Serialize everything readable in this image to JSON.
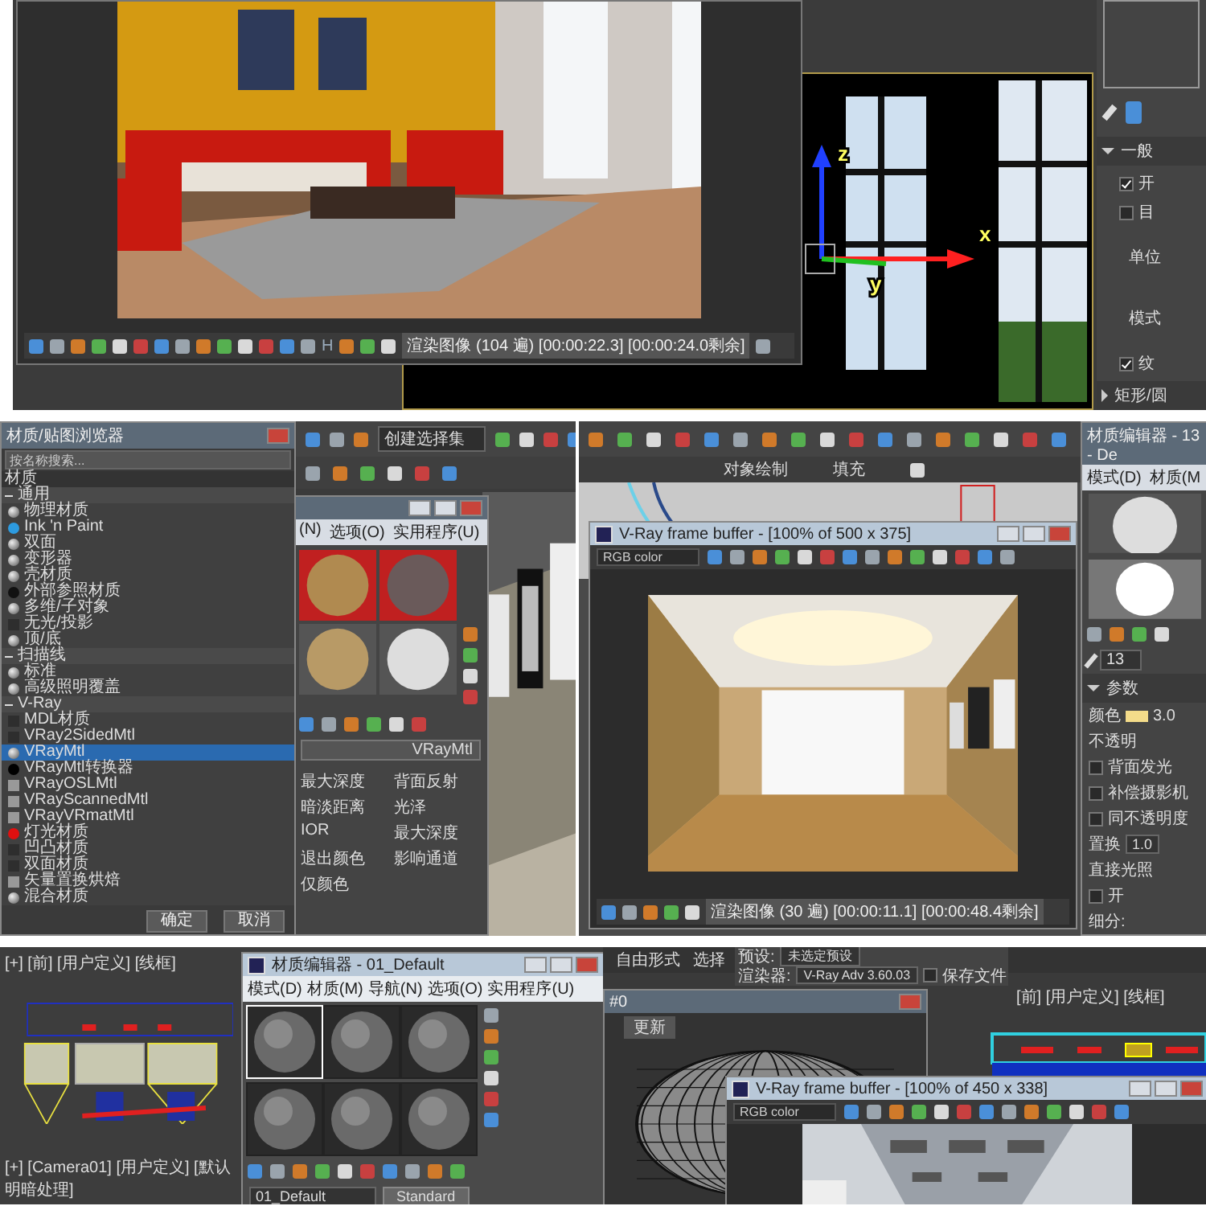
{
  "top_panel": {
    "render_window": {
      "toolbar_glyph": "H",
      "status": "渲染图像 (104 遍) [00:00:22.3] [00:00:24.0剩余]"
    },
    "viewport": {
      "axis_labels": [
        "z",
        "x",
        "y"
      ]
    },
    "command_panel": {
      "sections": [
        {
          "title": "一般",
          "expanded": true,
          "rows": [
            {
              "kind": "check",
              "label": "开",
              "checked": true
            },
            {
              "kind": "check",
              "label": "目",
              "checked": false
            },
            {
              "kind": "text",
              "label": "单位"
            },
            {
              "kind": "text",
              "label": "模式"
            },
            {
              "kind": "check",
              "label": "纹",
              "checked": true
            }
          ]
        },
        {
          "title": "矩形/圆",
          "expanded": false
        }
      ]
    }
  },
  "middle_left_panel": {
    "toolbar": {
      "dropdown": "创建选择集"
    },
    "material_browser": {
      "title": "材质/贴图浏览器",
      "search_placeholder": "按名称搜索...",
      "root": "材质",
      "groups": [
        {
          "title": "通用",
          "expanded": true,
          "items": [
            {
              "label": "物理材质",
              "kind": "sphere",
              "selected": false
            },
            {
              "label": "Ink 'n Paint",
              "kind": "dot",
              "color": "#2d9be0",
              "selected": false
            },
            {
              "label": "双面",
              "kind": "sphere",
              "selected": false
            },
            {
              "label": "变形器",
              "kind": "sphere",
              "selected": false
            },
            {
              "label": "壳材质",
              "kind": "sphere",
              "selected": false
            },
            {
              "label": "外部参照材质",
              "kind": "dot",
              "color": "#111111",
              "selected": false
            },
            {
              "label": "多维/子对象",
              "kind": "sphere",
              "selected": false
            },
            {
              "label": "无光/投影",
              "kind": "none",
              "selected": false
            },
            {
              "label": "顶/底",
              "kind": "sphere",
              "selected": false
            }
          ]
        },
        {
          "title": "扫描线",
          "expanded": true,
          "items": [
            {
              "label": "标准",
              "kind": "sphere",
              "selected": false
            },
            {
              "label": "高级照明覆盖",
              "kind": "sphere",
              "selected": false
            }
          ]
        },
        {
          "title": "V-Ray",
          "expanded": true,
          "items": [
            {
              "label": "MDL材质",
              "kind": "none",
              "selected": false
            },
            {
              "label": "VRay2SidedMtl",
              "kind": "none",
              "selected": false
            },
            {
              "label": "VRayMtl",
              "kind": "sphere",
              "selected": true
            },
            {
              "label": "VRayMtl转换器",
              "kind": "dot",
              "color": "#000000",
              "selected": false
            },
            {
              "label": "VRayOSLMtl",
              "kind": "swatch",
              "selected": false
            },
            {
              "label": "VRayScannedMtl",
              "kind": "swatch",
              "selected": false
            },
            {
              "label": "VRayVRmatMtl",
              "kind": "swatch",
              "selected": false
            },
            {
              "label": "灯光材质",
              "kind": "dot",
              "color": "#e01010",
              "selected": false
            },
            {
              "label": "凹凸材质",
              "kind": "none",
              "selected": false
            },
            {
              "label": "双面材质",
              "kind": "none",
              "selected": false
            },
            {
              "label": "矢量置换烘焙",
              "kind": "swatch",
              "selected": false
            },
            {
              "label": "混合材质",
              "kind": "sphere",
              "selected": false
            }
          ]
        }
      ],
      "buttons": [
        "确定",
        "取消"
      ]
    },
    "material_editor": {
      "menu": [
        "(N)",
        "选项(O)",
        "实用程序(U)"
      ],
      "material_type": "VRayMtl",
      "parameters": [
        "最大深度",
        "背面反射",
        "暗淡距离",
        "光泽",
        "IOR",
        "最大深度",
        "退出颜色",
        "影响通道",
        "仅颜色"
      ]
    }
  },
  "middle_right_panel": {
    "ribbon_labels": [
      "对象绘制",
      "填充"
    ],
    "frame_buffer": {
      "title": "V-Ray frame buffer - [100% of 500 x 375]",
      "channel": "RGB color",
      "status": "渲染图像 (30 遍) [00:00:11.1] [00:00:48.4剩余]"
    },
    "material_editor": {
      "title": "材质编辑器 - 13 - De",
      "menu": [
        "模式(D)",
        "材质(M"
      ],
      "slot_name": "13",
      "rollout": "参数",
      "rows": [
        {
          "kind": "color",
          "label": "颜色",
          "value": "3.0"
        },
        {
          "kind": "text",
          "label": "不透明"
        },
        {
          "kind": "check",
          "label": "背面发光",
          "checked": false
        },
        {
          "kind": "check",
          "label": "补偿摄影机",
          "checked": false
        },
        {
          "kind": "check",
          "label": "同不透明度",
          "checked": false
        },
        {
          "kind": "spinner",
          "label": "置换",
          "value": "1.0"
        },
        {
          "kind": "text",
          "label": "直接光照"
        },
        {
          "kind": "check",
          "label": "开",
          "checked": false
        },
        {
          "kind": "text",
          "label": "细分:"
        }
      ]
    }
  },
  "bottom_left_panel": {
    "viewport_label": "[+] [前] [用户定义] [线框]",
    "camera_label": "[+] [Camera01] [用户定义] [默认明暗处理]",
    "material_editor": {
      "title": "材质编辑器 - 01_Default",
      "menu": [
        "模式(D)",
        "材质(M)",
        "导航(N)",
        "选项(O)",
        "实用程序(U)"
      ],
      "slots": [
        {
          "selected": true
        },
        {
          "selected": false
        },
        {
          "selected": false
        },
        {
          "selected": false
        },
        {
          "selected": false
        },
        {
          "selected": false
        }
      ],
      "material_name": "01_Default",
      "material_type": "Standard"
    }
  },
  "bottom_right_panel": {
    "ribbon_labels": [
      "自由形式",
      "选择"
    ],
    "render_setup": {
      "fields": [
        {
          "label": "预设:",
          "value": "未选定预设"
        },
        {
          "label": "渲染器:",
          "value": "V-Ray Adv 3.60.03"
        }
      ],
      "save_file": {
        "label": "保存文件",
        "checked": false
      }
    },
    "viewport_label": "[前] [用户定义] [线框]",
    "preview_window": {
      "title": "#0",
      "tab": "更新"
    },
    "frame_buffer": {
      "title": "V-Ray frame buffer - [100% of 450 x 338]",
      "channel": "RGB color"
    }
  }
}
